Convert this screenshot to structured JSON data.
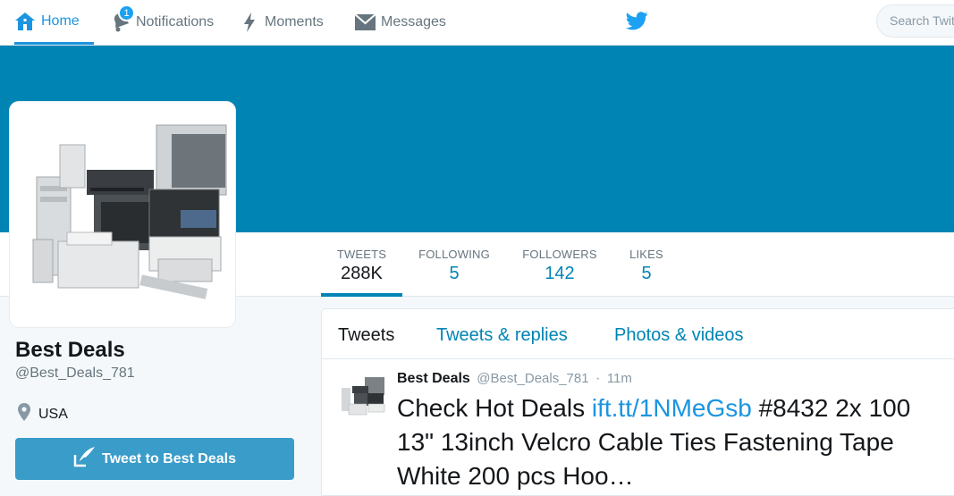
{
  "nav": {
    "home": "Home",
    "notifications": "Notifications",
    "notifications_badge": "1",
    "moments": "Moments",
    "messages": "Messages",
    "search_placeholder": "Search Twitter"
  },
  "colors": {
    "banner": "#0084b4",
    "accent": "#1b95e0",
    "button": "#3a9cc9"
  },
  "stats": {
    "tweets_label": "TWEETS",
    "tweets_value": "288K",
    "following_label": "FOLLOWING",
    "following_value": "5",
    "followers_label": "FOLLOWERS",
    "followers_value": "142",
    "likes_label": "LIKES",
    "likes_value": "5"
  },
  "profile": {
    "name": "Best Deals",
    "handle": "@Best_Deals_781",
    "location": "USA",
    "tweet_to_button": "Tweet to Best Deals"
  },
  "timeline": {
    "tabs": {
      "tweets": "Tweets",
      "replies": "Tweets & replies",
      "media": "Photos & videos"
    },
    "tweet": {
      "name": "Best Deals",
      "handle": "@Best_Deals_781",
      "separator": "·",
      "time": "11m",
      "text_before": "Check Hot Deals ",
      "link": "ift.tt/1NMeGsb",
      "text_after": " #8432 2x 100 13\" 13inch Velcro Cable Ties Fastening Tape White 200 pcs Hoo…"
    }
  },
  "icons": {
    "home": "home-icon",
    "notifications": "bell-icon",
    "moments": "lightning-icon",
    "messages": "envelope-icon",
    "logo": "twitter-bird-icon",
    "location": "location-pin-icon",
    "compose": "quill-icon"
  }
}
